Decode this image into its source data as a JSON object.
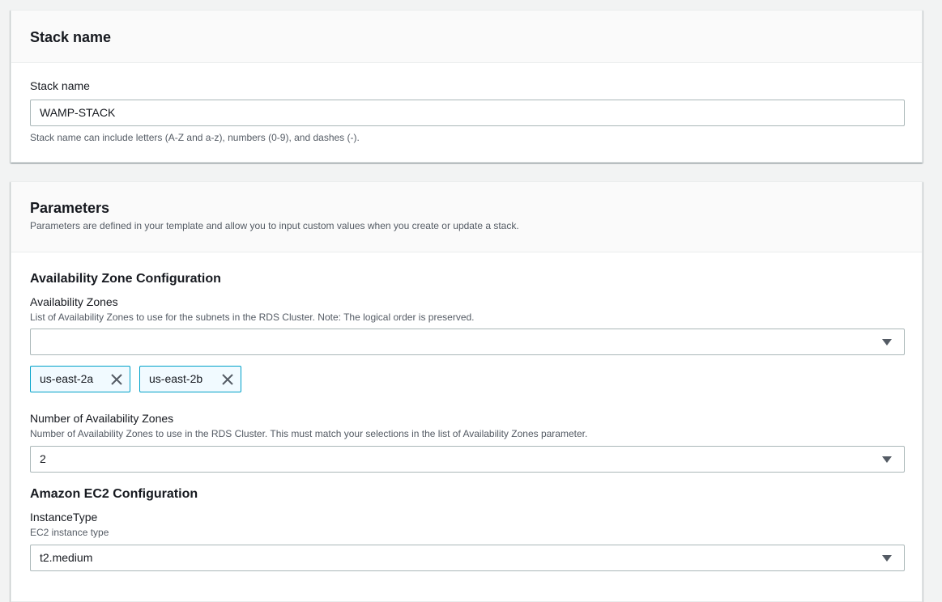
{
  "stack_section": {
    "title": "Stack name",
    "field_label": "Stack name",
    "field_value": "WAMP-STACK",
    "field_hint": "Stack name can include letters (A-Z and a-z), numbers (0-9), and dashes (-)."
  },
  "parameters_section": {
    "title": "Parameters",
    "description": "Parameters are defined in your template and allow you to input custom values when you create or update a stack.",
    "az_config": {
      "title": "Availability Zone Configuration",
      "az_label": "Availability Zones",
      "az_desc": "List of Availability Zones to use for the subnets in the RDS Cluster. Note: The logical order is preserved.",
      "az_value": "",
      "tokens": [
        "us-east-2a",
        "us-east-2b"
      ],
      "num_label": "Number of Availability Zones",
      "num_desc": "Number of Availability Zones to use in the RDS Cluster. This must match your selections in the list of Availability Zones parameter.",
      "num_value": "2"
    },
    "ec2_config": {
      "title": "Amazon EC2 Configuration",
      "instance_label": "InstanceType",
      "instance_desc": "EC2 instance type",
      "instance_value": "t2.medium"
    }
  },
  "icons": {
    "dropdown": "caret-down-icon",
    "remove": "close-icon"
  },
  "colors": {
    "token_border": "#00a1c9",
    "token_bg": "#f1faff",
    "page_bg": "#f2f3f3"
  }
}
